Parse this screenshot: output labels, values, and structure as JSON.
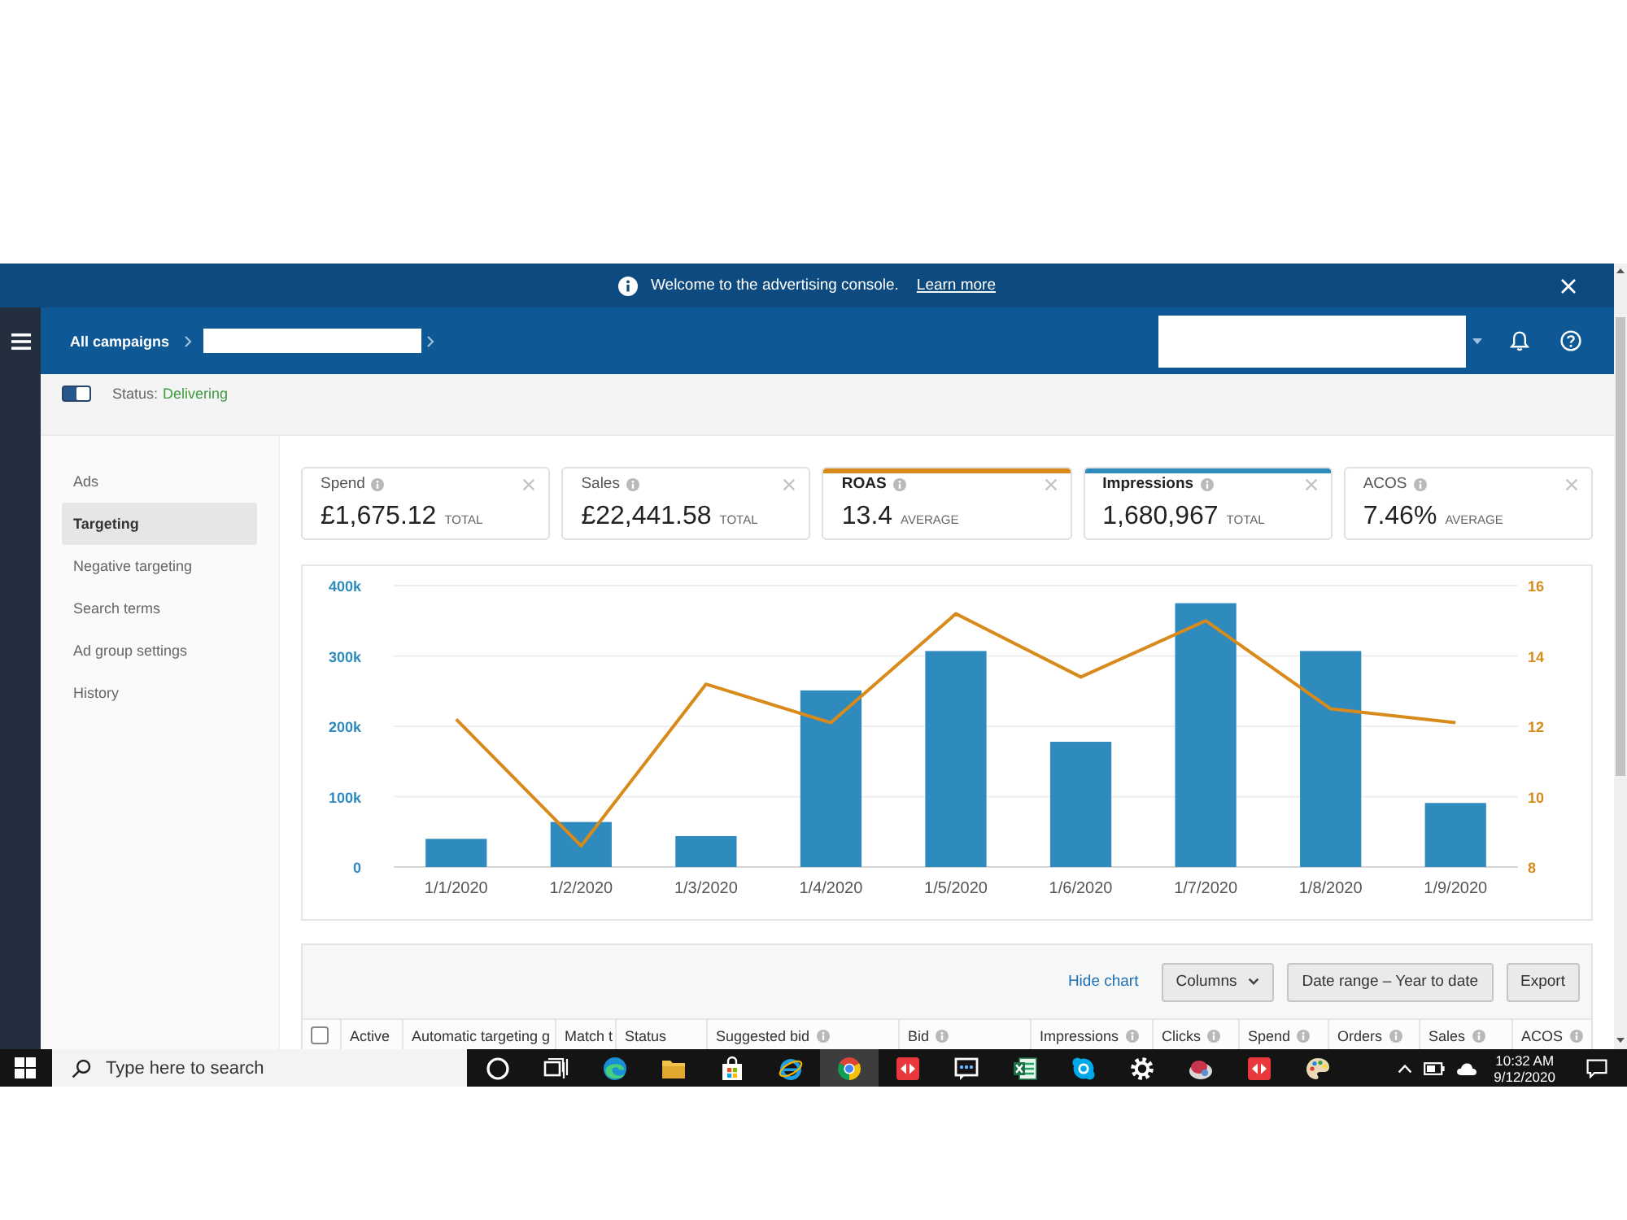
{
  "banner": {
    "message": "Welcome to the advertising console.",
    "link": "Learn more"
  },
  "header": {
    "breadcrumb": "All campaigns"
  },
  "status": {
    "label": "Status:",
    "value": "Delivering",
    "on": true
  },
  "sidebar": {
    "items": [
      {
        "label": "Ads",
        "selected": false
      },
      {
        "label": "Targeting",
        "selected": true
      },
      {
        "label": "Negative targeting",
        "selected": false
      },
      {
        "label": "Search terms",
        "selected": false
      },
      {
        "label": "Ad group settings",
        "selected": false
      },
      {
        "label": "History",
        "selected": false
      }
    ]
  },
  "metrics": [
    {
      "label": "Spend",
      "value": "£1,675.12",
      "unit": "TOTAL",
      "selected": false
    },
    {
      "label": "Sales",
      "value": "£22,441.58",
      "unit": "TOTAL",
      "selected": false
    },
    {
      "label": "ROAS",
      "value": "13.4",
      "unit": "AVERAGE",
      "selected": true,
      "color": "#d88a1a"
    },
    {
      "label": "Impressions",
      "value": "1,680,967",
      "unit": "TOTAL",
      "selected": true,
      "color": "#2f8bbd"
    },
    {
      "label": "ACOS",
      "value": "7.46%",
      "unit": "AVERAGE",
      "selected": false
    }
  ],
  "chart": {
    "chart_data": {
      "type": "bar",
      "categories": [
        "1/1/2020",
        "1/2/2020",
        "1/3/2020",
        "1/4/2020",
        "1/5/2020",
        "1/6/2020",
        "1/7/2020",
        "1/8/2020",
        "1/9/2020"
      ],
      "series": [
        {
          "type": "bar",
          "color": "#2f8bbd",
          "values": [
            40000,
            64000,
            44000,
            251000,
            307000,
            178000,
            375000,
            307000,
            91000
          ]
        },
        {
          "type": "line",
          "axis": "y2",
          "color": "#d88a1a",
          "values": [
            12.2,
            8.6,
            13.2,
            12.1,
            15.2,
            13.4,
            15.0,
            12.5,
            12.1
          ]
        }
      ],
      "ylim": [
        0,
        400000
      ],
      "yticks": [
        {
          "value": 0,
          "label": "0"
        },
        {
          "value": 100000,
          "label": "100k"
        },
        {
          "value": 200000,
          "label": "200k"
        },
        {
          "value": 300000,
          "label": "300k"
        },
        {
          "value": 400000,
          "label": "400k"
        }
      ],
      "y2lim": [
        8,
        16
      ],
      "y2ticks": [
        8,
        10,
        12,
        14,
        16
      ],
      "grid": true
    }
  },
  "table": {
    "toolbar": {
      "link": "Hide chart",
      "buttons": [
        {
          "label": "Columns",
          "kind": "dropdown"
        },
        {
          "label": "Date range – Year to date",
          "kind": "plain"
        },
        {
          "label": "Export",
          "kind": "plain"
        }
      ]
    },
    "select_all": {
      "checked": false
    },
    "columns": [
      {
        "label": "Active",
        "info": false
      },
      {
        "label": "Automatic targeting g",
        "info": false
      },
      {
        "label": "Match t",
        "info": false
      },
      {
        "label": "Status",
        "info": false
      },
      {
        "label": "Suggested bid",
        "info": true
      },
      {
        "label": "Bid",
        "info": true
      },
      {
        "label": "Impressions",
        "info": true
      },
      {
        "label": "Clicks",
        "info": true
      },
      {
        "label": "Spend",
        "info": true
      },
      {
        "label": "Orders",
        "info": true
      },
      {
        "label": "Sales",
        "info": true
      },
      {
        "label": "ACOS",
        "info": true
      }
    ]
  },
  "taskbar": {
    "search": {
      "placeholder": "Type here to search"
    },
    "apps": [
      {
        "kind": "ring",
        "selected": false
      },
      {
        "kind": "panes",
        "selected": false
      },
      {
        "kind": "swirl",
        "selected": false
      },
      {
        "kind": "folder",
        "selected": false
      },
      {
        "kind": "bag",
        "selected": false
      },
      {
        "kind": "orbit",
        "selected": false
      },
      {
        "kind": "wheel",
        "selected": true
      },
      {
        "kind": "red-tile",
        "selected": false
      },
      {
        "kind": "screen",
        "selected": false
      },
      {
        "kind": "sheet",
        "selected": false
      },
      {
        "kind": "bubble",
        "selected": false
      },
      {
        "kind": "gear",
        "selected": false
      },
      {
        "kind": "disc",
        "selected": false
      },
      {
        "kind": "red-tile",
        "selected": false
      },
      {
        "kind": "palette",
        "selected": false
      }
    ],
    "time": "10:32 AM",
    "date": "9/12/2020"
  }
}
